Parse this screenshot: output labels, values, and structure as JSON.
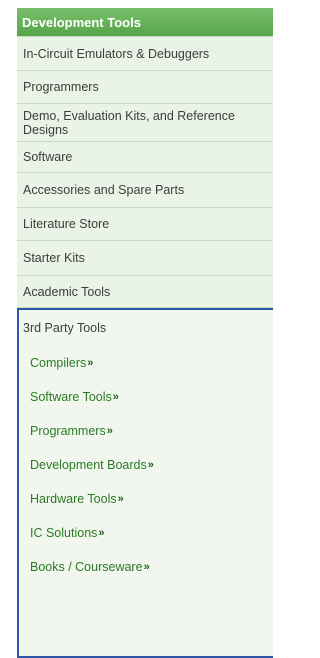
{
  "menu": {
    "header": "Development Tools",
    "items": [
      {
        "label": "In-Circuit Emulators & Debuggers"
      },
      {
        "label": "Programmers"
      },
      {
        "label": "Demo, Evaluation Kits, and Reference Designs"
      },
      {
        "label": "Software"
      },
      {
        "label": "Accessories and Spare Parts"
      },
      {
        "label": "Literature Store"
      },
      {
        "label": "Starter Kits"
      },
      {
        "label": "Academic Tools"
      }
    ],
    "third_party": {
      "title": "3rd Party Tools",
      "chevron": "»",
      "subitems": [
        {
          "label": "Compilers"
        },
        {
          "label": "Software Tools"
        },
        {
          "label": "Programmers"
        },
        {
          "label": "Development Boards"
        },
        {
          "label": "Hardware Tools"
        },
        {
          "label": "IC Solutions"
        },
        {
          "label": "Books / Courseware"
        }
      ]
    }
  },
  "colors": {
    "header_green": "#55a548",
    "item_background": "#e9f3e6",
    "submenu_text_green": "#2b7a23",
    "selected_border_blue": "#2f57a8"
  },
  "icons": {
    "subitem_arrow": "double-chevron-right-icon"
  }
}
